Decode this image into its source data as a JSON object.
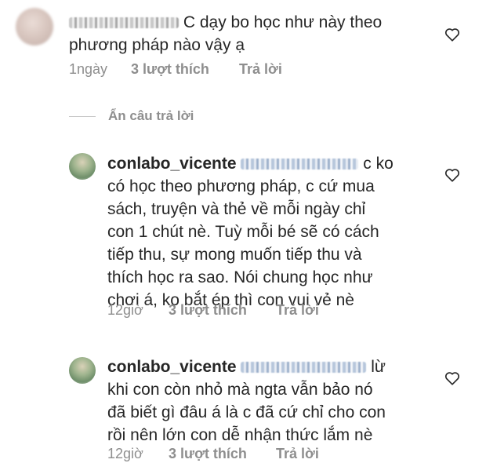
{
  "comments": [
    {
      "username": "",
      "text_lines": [
        "C dạy bo học như này theo",
        "phương pháp nào vậy ạ"
      ],
      "time": "1ngày",
      "likes": "3 lượt thích",
      "reply": "Trả lời"
    }
  ],
  "hide_replies": "Ẩn câu trả lời",
  "replies": [
    {
      "username": "conlabo_vicente",
      "text_lines": [
        "c ko",
        "có học theo phương pháp, c cứ mua",
        "sách, truyện và thẻ về mỗi ngày chỉ",
        "con 1 chút nè. Tuỳ mỗi bé sẽ có cách",
        "tiếp thu, sự mong muốn tiếp thu và",
        "thích học ra sao. Nói chung học như",
        "chơi á, ko bắt ép thì con vui vẻ nè"
      ],
      "time": "12giờ",
      "likes": "3 lượt thích",
      "reply": "Trả lời"
    },
    {
      "username": "conlabo_vicente",
      "text_lines": [
        "lừ",
        "khi con còn nhỏ mà ngta vẫn bảo nó",
        "đã biết gì đâu á là c đã cứ chỉ cho con",
        "rồi nên lớn con dễ nhận thức lắm nè"
      ],
      "time": "12giờ",
      "likes": "3 lượt thích",
      "reply": "Trả lời"
    }
  ],
  "icons": {
    "like": "heart-outline-icon"
  },
  "colors": {
    "text": "#262626",
    "meta": "#8e8e8e"
  }
}
